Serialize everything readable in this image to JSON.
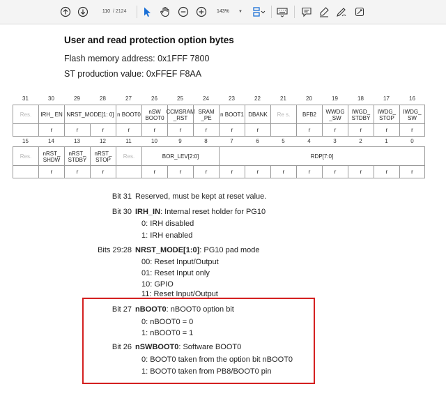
{
  "toolbar": {
    "page_current": "110",
    "page_total": "/ 2124",
    "zoom": "143%",
    "icons": [
      "arrow-up-circle-icon",
      "arrow-down-circle-icon",
      "pointer-icon",
      "hand-icon",
      "zoom-out-icon",
      "zoom-in-icon",
      "page-layout-icon",
      "keyboard-icon",
      "comment-icon",
      "highlight-pen-icon",
      "draw-icon",
      "tools-icon"
    ]
  },
  "doc": {
    "title": "User and read protection option bytes",
    "flash_address": "Flash memory address: 0x1FFF 7800",
    "production_value": "ST production value: 0xFFEF F8AA"
  },
  "register": {
    "upper_bits": [
      "31",
      "30",
      "29",
      "28",
      "27",
      "26",
      "25",
      "24",
      "23",
      "22",
      "21",
      "20",
      "19",
      "18",
      "17",
      "16"
    ],
    "upper_fields": [
      {
        "label": "Res.",
        "reserved": true
      },
      {
        "label": "IRH_ EN"
      },
      {
        "label": "NRST_MODE[1: 0]"
      },
      {
        "label": "n BOOT0"
      },
      {
        "label": "nSW BOOT0"
      },
      {
        "label": "CCMSRAM _RST"
      },
      {
        "label": "SRAM _PE"
      },
      {
        "label": "n BOOT1"
      },
      {
        "label": "DBANK"
      },
      {
        "label": "Re s.",
        "reserved": true
      },
      {
        "label": "BFB2"
      },
      {
        "label": "WWDG _SW"
      },
      {
        "label": "IWGD_ STDBY"
      },
      {
        "label": "IWDG_ STOP"
      },
      {
        "label": "IWDG_ SW"
      }
    ],
    "upper_access": [
      "",
      "r",
      "r",
      "r",
      "r",
      "r",
      "r",
      "r",
      "r",
      "r",
      "",
      "r",
      "r",
      "r",
      "r",
      "r"
    ],
    "lower_bits": [
      "15",
      "14",
      "13",
      "12",
      "11",
      "10",
      "9",
      "8",
      "7",
      "6",
      "5",
      "4",
      "3",
      "2",
      "1",
      "0"
    ],
    "lower_fields": [
      {
        "label": "Res.",
        "reserved": true
      },
      {
        "label": "nRST_ SHDW"
      },
      {
        "label": "nRST_ STDBY"
      },
      {
        "label": "nRST_ STOP"
      },
      {
        "label": "Res.",
        "reserved": true
      },
      {
        "label": "BOR_LEV[2:0]"
      },
      {
        "label": "RDP[7:0]"
      }
    ],
    "lower_access": [
      "",
      "r",
      "r",
      "r",
      "",
      "r",
      "r",
      "r",
      "r",
      "r",
      "r",
      "r",
      "r",
      "r",
      "r",
      "r"
    ]
  },
  "bits": [
    {
      "label": "Bit 31",
      "name": "",
      "desc": "Reserved, must be kept at reset value.",
      "options": []
    },
    {
      "label": "Bit 30",
      "name": "IRH_IN",
      "desc": ": Internal reset holder for PG10",
      "options": [
        "0: IRH disabled",
        "1: IRH enabled"
      ]
    },
    {
      "label": "Bits 29:28",
      "name": "NRST_MODE[1:0]",
      "desc": ": PG10 pad mode",
      "options": [
        "00: Reset Input/Output",
        "01: Reset Input only",
        "10: GPIO",
        "11: Reset Input/Output"
      ]
    },
    {
      "label": "Bit 27",
      "name": "nBOOT0",
      "desc": ": nBOOT0 option bit",
      "options": [
        "0: nBOOT0 = 0",
        "1: nBOOT0 = 1"
      ]
    },
    {
      "label": "Bit 26",
      "name": "nSWBOOT0",
      "desc": ": Software BOOT0",
      "options": [
        "0: BOOT0 taken from the option bit nBOOT0",
        "1: BOOT0 taken from PB8/BOOT0 pin"
      ]
    }
  ],
  "colors": {
    "highlight_border": "#d42020",
    "toolbar_accent": "#1a6fd6"
  }
}
